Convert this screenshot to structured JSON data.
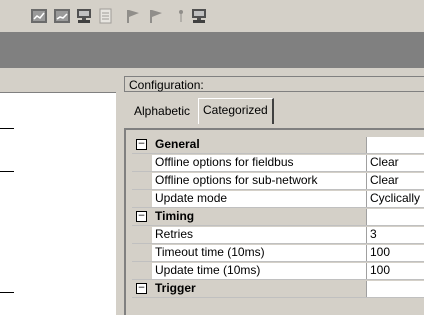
{
  "config_label": "Configuration:",
  "tabs": [
    {
      "label": "Alphabetic"
    },
    {
      "label": "Categorized"
    }
  ],
  "toolbar_icons": [
    "grid-icon",
    "grid-icon-2",
    "computer-icon",
    "document-icon",
    "flag-icon",
    "flag-icon-2",
    "pin-icon",
    "monitor-icon"
  ],
  "grid": {
    "sections": [
      {
        "name": "General",
        "expander": "−",
        "items": [
          {
            "name": "Offline options for fieldbus",
            "value": "Clear"
          },
          {
            "name": "Offline options for sub-network",
            "value": "Clear"
          },
          {
            "name": "Update mode",
            "value": "Cyclically"
          }
        ]
      },
      {
        "name": "Timing",
        "expander": "−",
        "items": [
          {
            "name": "Retries",
            "value": "3"
          },
          {
            "name": "Timeout time (10ms)",
            "value": "100"
          },
          {
            "name": "Update time (10ms)",
            "value": "100"
          }
        ]
      },
      {
        "name": "Trigger",
        "expander": "−",
        "items": []
      }
    ]
  }
}
